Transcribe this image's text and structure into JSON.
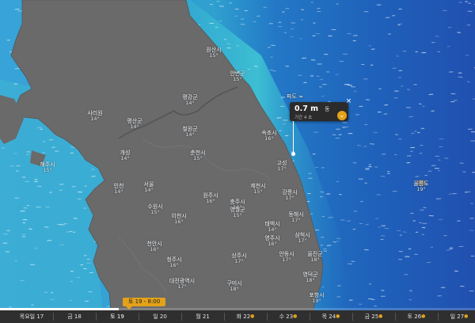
{
  "popup": {
    "title": "파도 ≈",
    "value": "0.7 m",
    "unit": "동",
    "sub": "기간 4 초",
    "download_icon": "chevron-down-icon",
    "close_icon": "close-icon"
  },
  "time_pill": "토 19 - 8:00",
  "progress": 0.25,
  "timeline": [
    {
      "label": "목요일 17",
      "star": false,
      "active": false
    },
    {
      "label": "금 18",
      "star": false,
      "active": false
    },
    {
      "label": "토 19",
      "star": false,
      "active": true
    },
    {
      "label": "일 20",
      "star": false,
      "active": false
    },
    {
      "label": "월 21",
      "star": false,
      "active": false
    },
    {
      "label": "화 22",
      "star": true,
      "active": false
    },
    {
      "label": "수 23",
      "star": true,
      "active": false
    },
    {
      "label": "목 24",
      "star": true,
      "active": false
    },
    {
      "label": "금 25",
      "star": true,
      "active": false
    },
    {
      "label": "토 26",
      "star": true,
      "active": false
    },
    {
      "label": "일 27",
      "star": true,
      "active": false
    }
  ],
  "cities": [
    {
      "name": "고성",
      "temp": "17°"
    },
    {
      "name": "속초시",
      "temp": "16°"
    },
    {
      "name": "강릉시",
      "temp": "17°"
    },
    {
      "name": "동해시",
      "temp": "17°"
    },
    {
      "name": "삼척시",
      "temp": "17°"
    },
    {
      "name": "울진군",
      "temp": "18°"
    },
    {
      "name": "영덕군",
      "temp": "18°"
    },
    {
      "name": "포항시",
      "temp": "19°"
    },
    {
      "name": "서울",
      "temp": "14°"
    },
    {
      "name": "인천",
      "temp": "14°"
    },
    {
      "name": "수원시",
      "temp": "15°"
    },
    {
      "name": "춘천시",
      "temp": "15°"
    },
    {
      "name": "원주시",
      "temp": "16°"
    },
    {
      "name": "이천시",
      "temp": "16°"
    },
    {
      "name": "충주시",
      "temp": "16°"
    },
    {
      "name": "제천시",
      "temp": "15°"
    },
    {
      "name": "태백시",
      "temp": "14°"
    },
    {
      "name": "영월군",
      "temp": "15°"
    },
    {
      "name": "안동시",
      "temp": "17°"
    },
    {
      "name": "영주시",
      "temp": "16°"
    },
    {
      "name": "청주시",
      "temp": "16°"
    },
    {
      "name": "천안시",
      "temp": "16°"
    },
    {
      "name": "대전광역시",
      "temp": "17°"
    },
    {
      "name": "상주시",
      "temp": "17°"
    },
    {
      "name": "구미시",
      "temp": "18°"
    },
    {
      "name": "개성",
      "temp": "14°"
    },
    {
      "name": "해주시",
      "temp": "15°"
    },
    {
      "name": "사리원",
      "temp": "14°"
    },
    {
      "name": "평산군",
      "temp": "14°"
    },
    {
      "name": "철원군",
      "temp": "14°"
    },
    {
      "name": "원산시",
      "temp": "15°"
    },
    {
      "name": "안변군",
      "temp": "15°"
    },
    {
      "name": "평강군",
      "temp": "14°"
    },
    {
      "name": "울릉도",
      "temp": "19°"
    }
  ]
}
